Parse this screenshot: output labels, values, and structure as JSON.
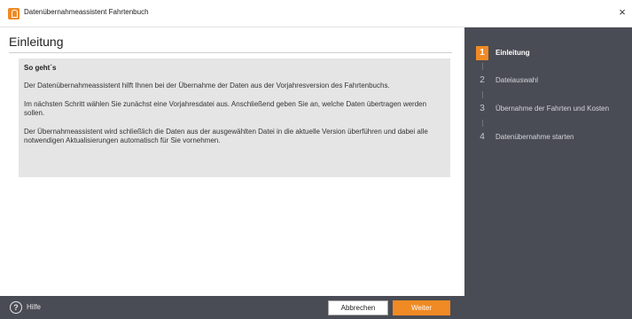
{
  "window": {
    "title": "Datenübernahmeassistent Fahrtenbuch",
    "close_glyph": "×",
    "app_icon": "app-logo-icon"
  },
  "main": {
    "page_title": "Einleitung",
    "heading": "So geht´s",
    "paragraphs": [
      "Der Datenübernahmeassistent hilft Ihnen bei der Übernahme der Daten aus der Vorjahresversion des Fahrtenbuchs.",
      "Im nächsten Schritt wählen Sie zunächst eine Vorjahresdatei aus. Anschließend geben Sie an, welche Daten übertragen werden sollen.",
      "Der Übernahmeassistent wird schließlich die Daten aus der ausgewählten Datei in die aktuelle Version überführen und dabei alle notwendigen Aktualisierungen automatisch für Sie vornehmen."
    ]
  },
  "steps": [
    {
      "number": "1",
      "label": "Einleitung",
      "active": true
    },
    {
      "number": "2",
      "label": "Dateiauswahl",
      "active": false
    },
    {
      "number": "3",
      "label": "Übernahme der Fahrten und Kosten",
      "active": false
    },
    {
      "number": "4",
      "label": "Datenübernahme starten",
      "active": false
    }
  ],
  "footer": {
    "help_glyph": "?",
    "help_label": "Hilfe",
    "cancel_label": "Abbrechen",
    "next_label": "Weiter"
  },
  "colors": {
    "accent": "#f08a24",
    "sidebar": "#4a4c55",
    "info_box": "#e5e5e5"
  }
}
